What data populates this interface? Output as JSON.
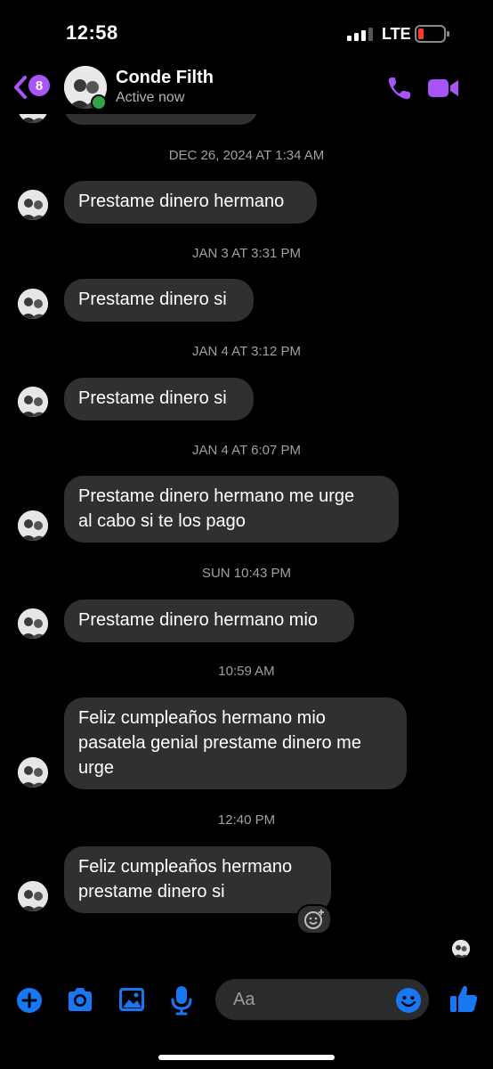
{
  "status_bar": {
    "time": "12:58",
    "network": "LTE",
    "signal_bars_filled": 3,
    "battery_level": 0.15
  },
  "header": {
    "back_badge_count": "8",
    "contact_name": "Conde Filth",
    "contact_status": "Active now",
    "icons": [
      "back-chevron-icon",
      "phone-icon",
      "video-camera-icon"
    ],
    "accent_color": "#a855f7"
  },
  "conversation": {
    "timestamps": [
      "DEC 26, 2024 AT 1:34 AM",
      "JAN 3 AT 3:31 PM",
      "JAN 4 AT 3:12 PM",
      "JAN 4 AT 6:07 PM",
      "SUN 10:43 PM",
      "10:59 AM",
      "12:40 PM"
    ],
    "messages": [
      {
        "lines": [
          "Prestame dinero hermano"
        ]
      },
      {
        "lines": [
          "Prestame dinero si"
        ]
      },
      {
        "lines": [
          "Prestame dinero si"
        ]
      },
      {
        "lines": [
          "Prestame dinero hermano me urge",
          "al cabo si te los pago"
        ]
      },
      {
        "lines": [
          "Prestame dinero hermano mio"
        ]
      },
      {
        "lines": [
          "Feliz cumpleaños hermano mio",
          "pasatela genial prestame dinero me",
          "urge"
        ]
      },
      {
        "lines": [
          "Feliz cumpleaños hermano",
          "prestame dinero si"
        ]
      }
    ]
  },
  "composer": {
    "placeholder": "Aa",
    "icons": [
      "plus-icon",
      "camera-icon",
      "gallery-icon",
      "microphone-icon",
      "emoji-icon",
      "thumbs-up-icon"
    ],
    "accent_color": "#1877f2"
  }
}
